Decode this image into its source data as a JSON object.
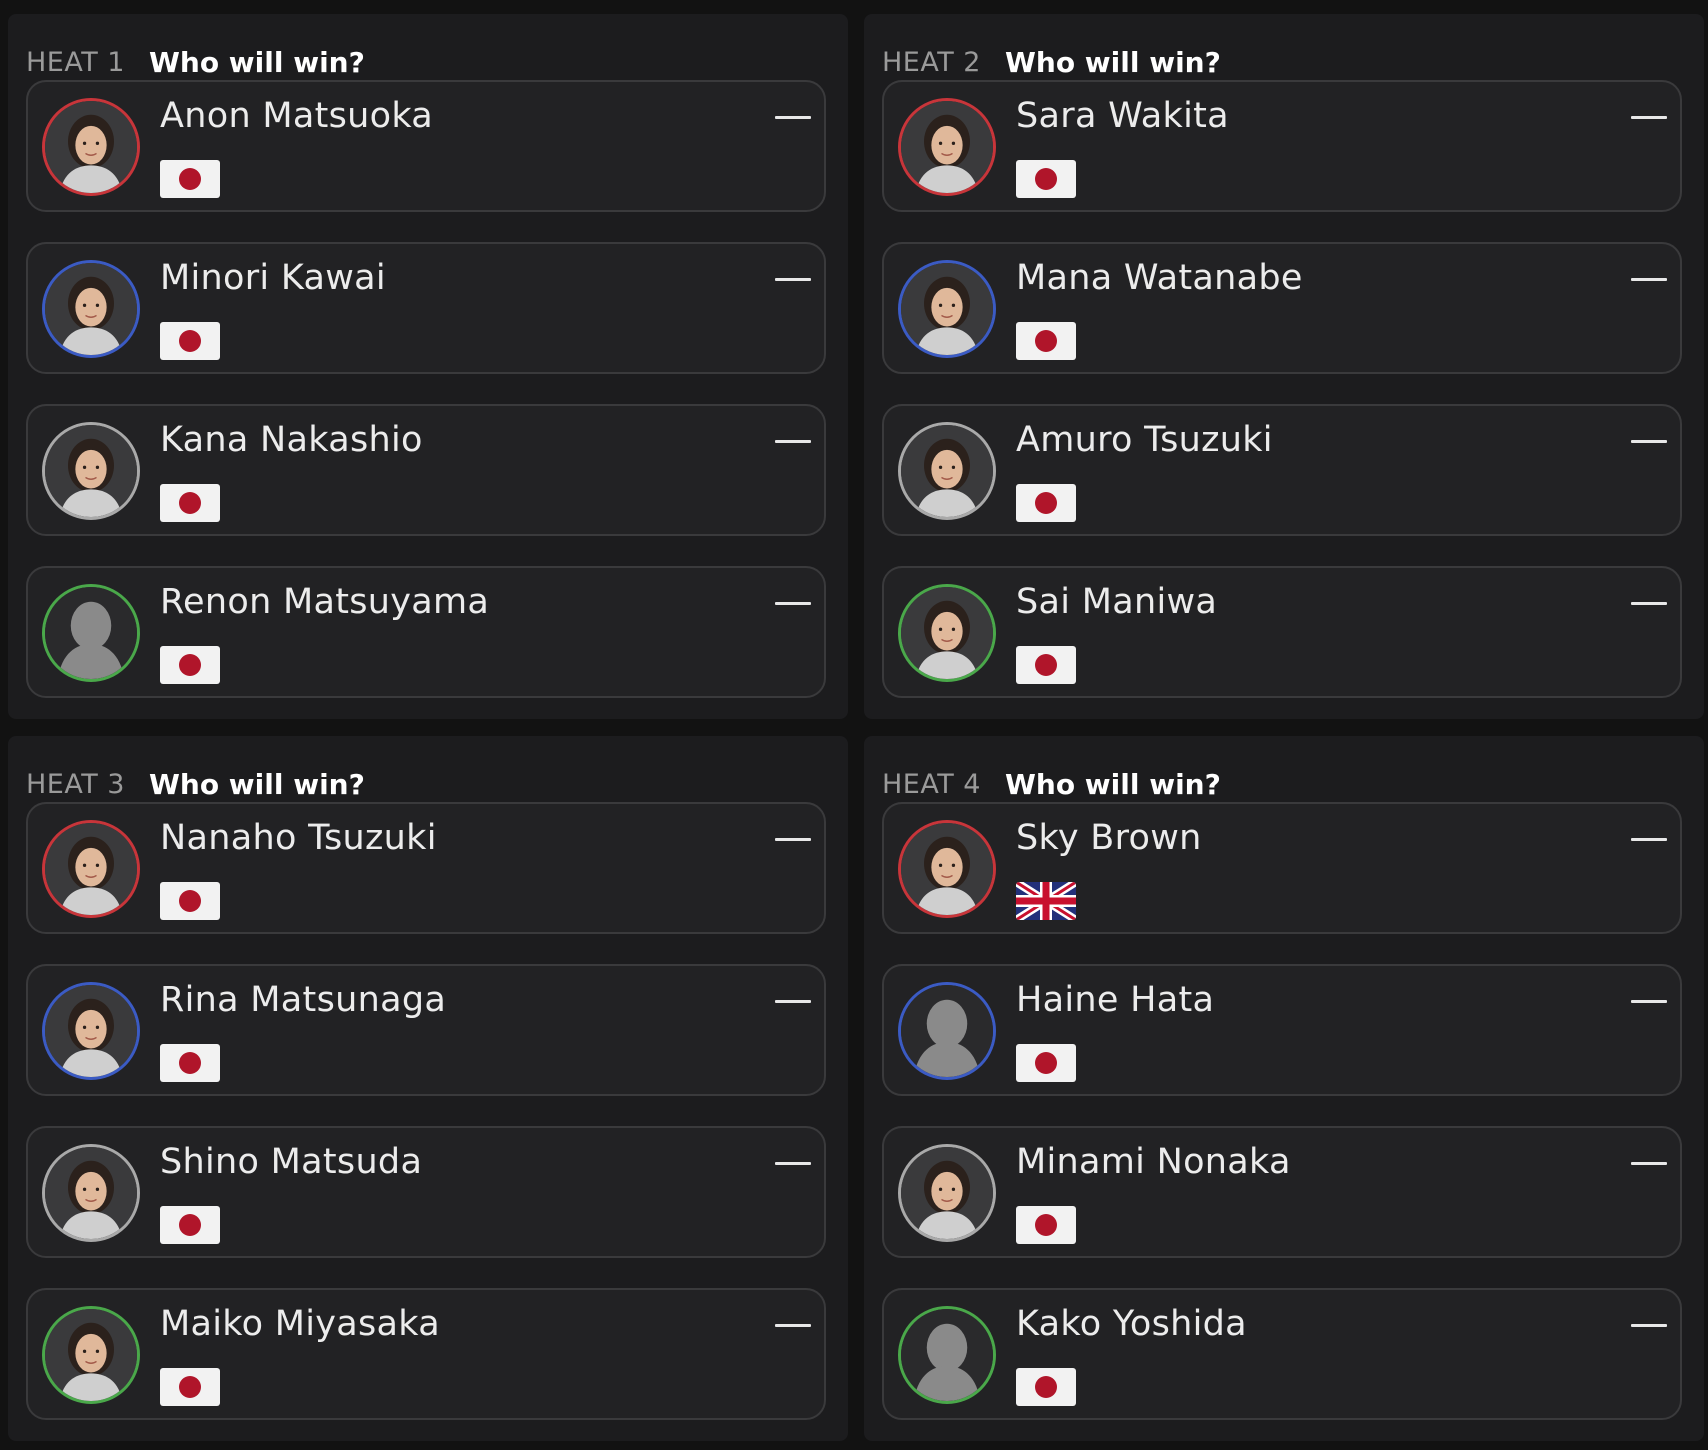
{
  "heats": [
    {
      "label": "HEAT 1",
      "question": "Who will win?",
      "riders": [
        {
          "name": "Anon Matsuoka",
          "flag": "japan-flag",
          "ring": "#c8353a",
          "avatar": "photo",
          "pick": "—"
        },
        {
          "name": "Minori Kawai",
          "flag": "japan-flag",
          "ring": "#3b5bc4",
          "avatar": "photo",
          "pick": "—"
        },
        {
          "name": "Kana Nakashio",
          "flag": "japan-flag",
          "ring": "#a9a9a9",
          "avatar": "photo",
          "pick": "—"
        },
        {
          "name": "Renon Matsuyama",
          "flag": "japan-flag",
          "ring": "#4aa84a",
          "avatar": "silhouette",
          "pick": "—"
        }
      ]
    },
    {
      "label": "HEAT 2",
      "question": "Who will win?",
      "riders": [
        {
          "name": "Sara Wakita",
          "flag": "japan-flag",
          "ring": "#c8353a",
          "avatar": "photo",
          "pick": "—"
        },
        {
          "name": "Mana Watanabe",
          "flag": "japan-flag",
          "ring": "#3b5bc4",
          "avatar": "photo",
          "pick": "—"
        },
        {
          "name": "Amuro Tsuzuki",
          "flag": "japan-flag",
          "ring": "#a9a9a9",
          "avatar": "photo",
          "pick": "—"
        },
        {
          "name": "Sai Maniwa",
          "flag": "japan-flag",
          "ring": "#4aa84a",
          "avatar": "photo",
          "pick": "—"
        }
      ]
    },
    {
      "label": "HEAT 3",
      "question": "Who will win?",
      "riders": [
        {
          "name": "Nanaho Tsuzuki",
          "flag": "japan-flag",
          "ring": "#c8353a",
          "avatar": "photo",
          "pick": "—"
        },
        {
          "name": "Rina Matsunaga",
          "flag": "japan-flag",
          "ring": "#3b5bc4",
          "avatar": "photo",
          "pick": "—"
        },
        {
          "name": "Shino Matsuda",
          "flag": "japan-flag",
          "ring": "#a9a9a9",
          "avatar": "photo",
          "pick": "—"
        },
        {
          "name": "Maiko Miyasaka",
          "flag": "japan-flag",
          "ring": "#4aa84a",
          "avatar": "photo",
          "pick": "—"
        }
      ]
    },
    {
      "label": "HEAT 4",
      "question": "Who will win?",
      "riders": [
        {
          "name": "Sky Brown",
          "flag": "uk-flag",
          "ring": "#c8353a",
          "avatar": "photo",
          "pick": "—"
        },
        {
          "name": "Haine Hata",
          "flag": "japan-flag",
          "ring": "#3b5bc4",
          "avatar": "silhouette",
          "pick": "—"
        },
        {
          "name": "Minami Nonaka",
          "flag": "japan-flag",
          "ring": "#a9a9a9",
          "avatar": "photo",
          "pick": "—"
        },
        {
          "name": "Kako Yoshida",
          "flag": "japan-flag",
          "ring": "#4aa84a",
          "avatar": "silhouette",
          "pick": "—"
        }
      ]
    }
  ]
}
